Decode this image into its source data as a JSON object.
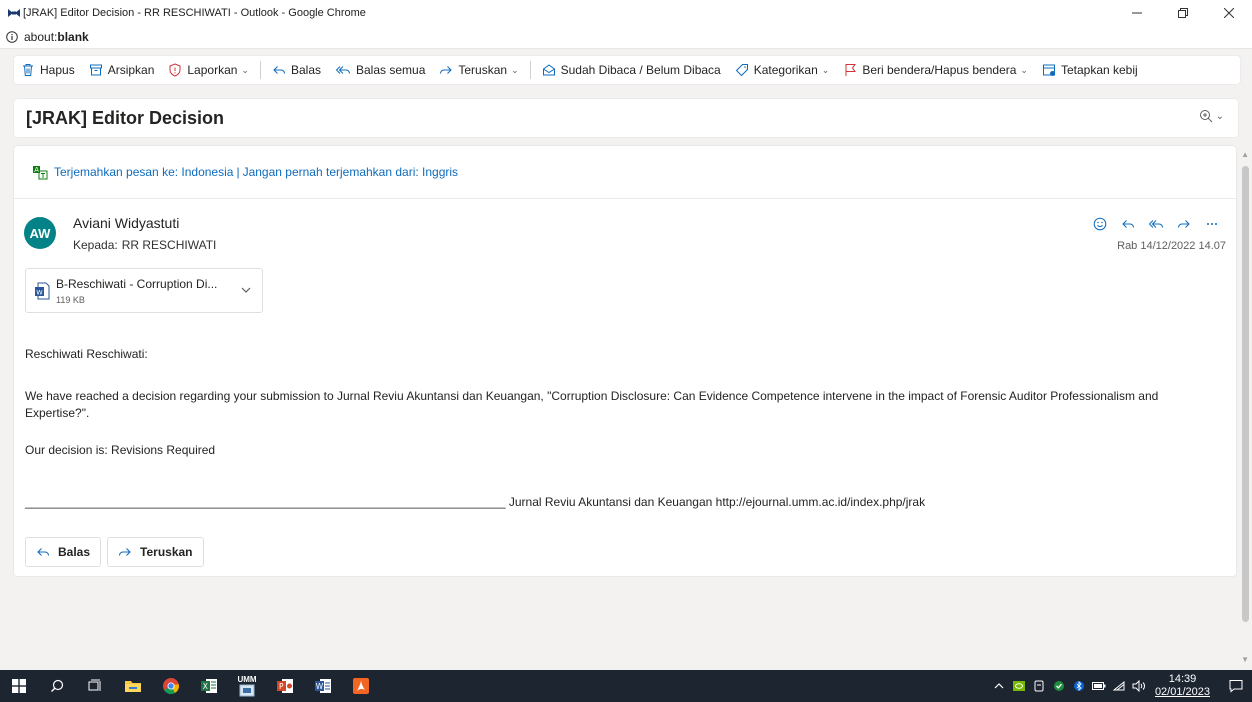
{
  "browser": {
    "window_title": "[JRAK] Editor Decision - RR RESCHIWATI - Outlook - Google Chrome",
    "url_prefix": "about:",
    "url_host": "blank"
  },
  "toolbar": {
    "delete": "Hapus",
    "archive": "Arsipkan",
    "report": "Laporkan",
    "reply": "Balas",
    "reply_all": "Balas semua",
    "forward": "Teruskan",
    "read_unread": "Sudah Dibaca / Belum Dibaca",
    "categorize": "Kategorikan",
    "flag": "Beri bendera/Hapus bendera",
    "policy": "Tetapkan kebij"
  },
  "subject": "[JRAK] Editor Decision",
  "translation": {
    "translate_link": "Terjemahkan pesan ke: Indonesia",
    "separator": "|",
    "never_link": "Jangan pernah terjemahkan dari: Inggris"
  },
  "message": {
    "avatar_initials": "AW",
    "sender": "Aviani Widyastuti",
    "to_label": "Kepada:",
    "to": "RR RESCHIWATI",
    "date": "Rab 14/12/2022 14.07",
    "attachment": {
      "name": "B-Reschiwati - Corruption Di...",
      "size": "119 KB",
      "icon": "word-doc-icon"
    },
    "greeting": "Reschiwati Reschiwati:",
    "paragraph": "We have reached a decision regarding your submission to Jurnal Reviu Akuntansi dan Keuangan, \"Corruption Disclosure: Can Evidence Competence intervene in the impact of Forensic Auditor Professionalism and Expertise?\".",
    "decision": "Our decision is: Revisions Required",
    "footer": "________________________________________________________________________ Jurnal Reviu Akuntansi dan Keuangan http://ejournal.umm.ac.id/index.php/jrak"
  },
  "reply_buttons": {
    "reply": "Balas",
    "forward": "Teruskan"
  },
  "taskbar": {
    "time": "14:39",
    "date": "02/01/2023",
    "umm_label": "UMM"
  },
  "colors": {
    "accent": "#0f6cbd",
    "avatar": "#038387",
    "taskbar": "#1d2531"
  }
}
